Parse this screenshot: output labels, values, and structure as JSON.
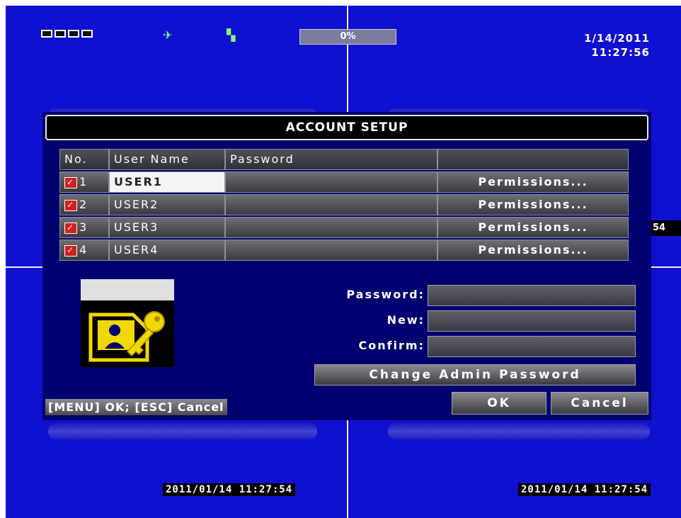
{
  "status": {
    "hdd_percent": "0%",
    "date": "1/14/2011",
    "time": "11:27:56"
  },
  "stamps": {
    "left": "2011/01/14 11:27:54",
    "right": "2011/01/14 11:27:54",
    "side": "54"
  },
  "dialog": {
    "title": "ACCOUNT SETUP",
    "headers": {
      "no": "No.",
      "user": "User Name",
      "password": "Password",
      "perm": ""
    },
    "rows": [
      {
        "no": "1",
        "user": "USER1",
        "password": "",
        "perm": "Permissions..."
      },
      {
        "no": "2",
        "user": "USER2",
        "password": "",
        "perm": "Permissions..."
      },
      {
        "no": "3",
        "user": "USER3",
        "password": "",
        "perm": "Permissions..."
      },
      {
        "no": "4",
        "user": "USER4",
        "password": "",
        "perm": "Permissions..."
      }
    ],
    "admin": {
      "password_label": "Password:",
      "new_label": "New:",
      "confirm_label": "Confirm:",
      "change_button": "Change Admin Password"
    },
    "hint": "[MENU] OK; [ESC] Cancel",
    "ok_button": "OK",
    "cancel_button": "Cancel"
  },
  "icons": [
    "channel-grid-icon",
    "network-icon",
    "record-icon",
    "account-key-icon",
    "checkbox-icon"
  ],
  "colors": {
    "background": "#1010d0",
    "dialog": "#000070",
    "checkbox": "#d02020",
    "icon_green": "#7dff7d",
    "graphic_yellow": "#f0d800"
  }
}
